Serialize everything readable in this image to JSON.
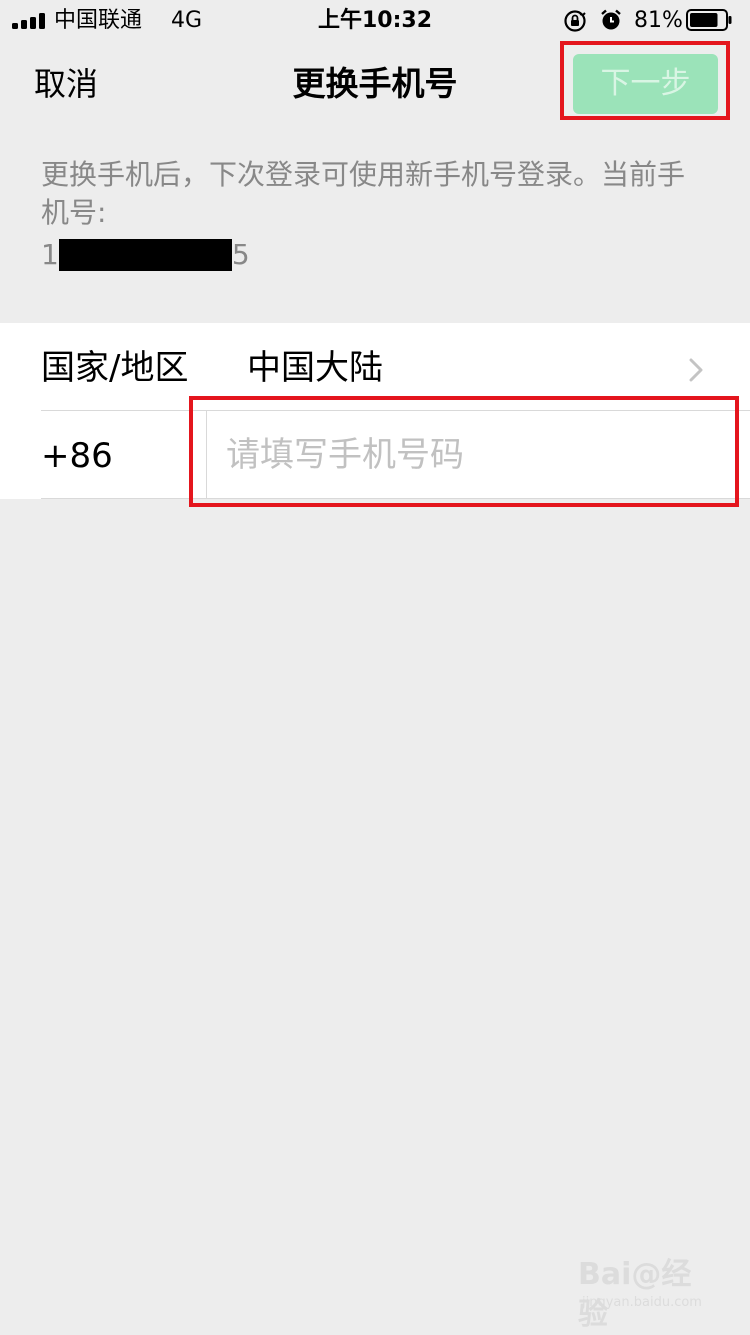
{
  "status_bar": {
    "carrier": "中国联通",
    "network": "4G",
    "time": "上午10:32",
    "battery": "81%",
    "battery_level": 0.81,
    "icons": [
      "signal-icon",
      "orientation-lock-icon",
      "alarm-icon",
      "battery-icon"
    ]
  },
  "nav": {
    "cancel": "取消",
    "title": "更换手机号",
    "next": "下一步"
  },
  "description": {
    "text": "更换手机后，下次登录可使用新手机号登录。当前手机号:",
    "phone_prefix": "1",
    "phone_suffix": "5"
  },
  "form": {
    "region_label": "国家/地区",
    "region_value": "中国大陆",
    "country_code": "+86",
    "phone_placeholder": "请填写手机号码",
    "phone_value": ""
  },
  "watermark": {
    "main": "Bai@经验",
    "sub": "jingyan.baidu.com"
  },
  "colors": {
    "background": "#ededed",
    "next_button_disabled": "#9be3b9",
    "annotation_red": "#e4151d"
  }
}
